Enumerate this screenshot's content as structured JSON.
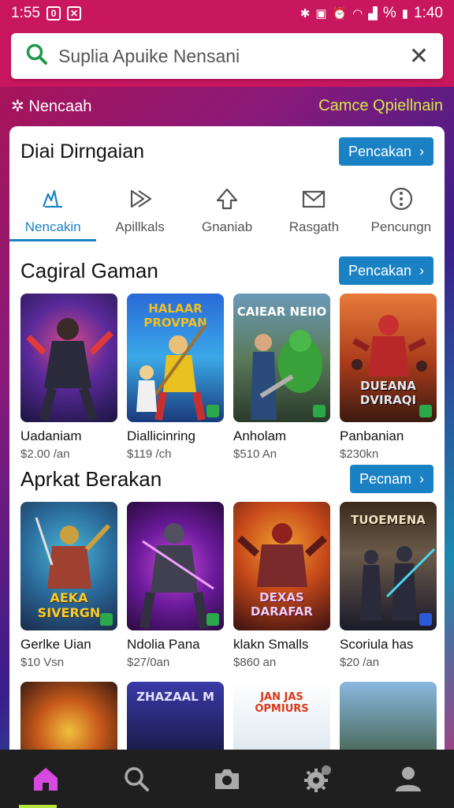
{
  "status": {
    "time_left": "1:55",
    "time_right": "1:40",
    "pct": "%"
  },
  "search": {
    "query": "Suplia Apuike Nensani"
  },
  "banner": {
    "left": "Nencaah",
    "right": "Camce Qpiellnain"
  },
  "card": {
    "title": "Diai Dirngaian",
    "action": "Pencakan"
  },
  "tabs": [
    {
      "label": "Nencakin",
      "icon": "apps-icon",
      "active": true
    },
    {
      "label": "Apillkals",
      "icon": "play-arrow-icon",
      "active": false
    },
    {
      "label": "Gnaniab",
      "icon": "arrow-up-icon",
      "active": false
    },
    {
      "label": "Rasgath",
      "icon": "mail-icon",
      "active": false
    },
    {
      "label": "Pencungn",
      "icon": "more-icon",
      "active": false
    }
  ],
  "sections": [
    {
      "title": "Cagiral Gaman",
      "action": "Pencakan",
      "items": [
        {
          "name": "Uadaniam",
          "price": "$2.00 /an"
        },
        {
          "name": "Diallicinring",
          "price": "$119 /ch",
          "art": "HALAAR PROVPAN"
        },
        {
          "name": "Anholam",
          "price": "$510 An",
          "art": "CAIEAR NEIIO"
        },
        {
          "name": "Panbanian",
          "price": "$230kn",
          "art": "DUEANA DVIRAQI"
        }
      ]
    },
    {
      "title": "Aprkat Berakan",
      "action": "Pecnam",
      "items": [
        {
          "name": "Gerlke Uian",
          "price": "$10 Vsn",
          "art": "AEKA SIVERGN"
        },
        {
          "name": "Ndolia Pana",
          "price": "$27/0an"
        },
        {
          "name": "klakn Smalls",
          "price": "$860 an",
          "art": "DEXAS DARAFAR"
        },
        {
          "name": "Scoriula has",
          "price": "$20 /an",
          "art": "TUOEMENA"
        }
      ]
    }
  ],
  "peek": [
    {
      "art": ""
    },
    {
      "art": "ZHAZAAL M"
    },
    {
      "art": "JAN JAS OPMIURS"
    },
    {
      "art": ""
    }
  ]
}
